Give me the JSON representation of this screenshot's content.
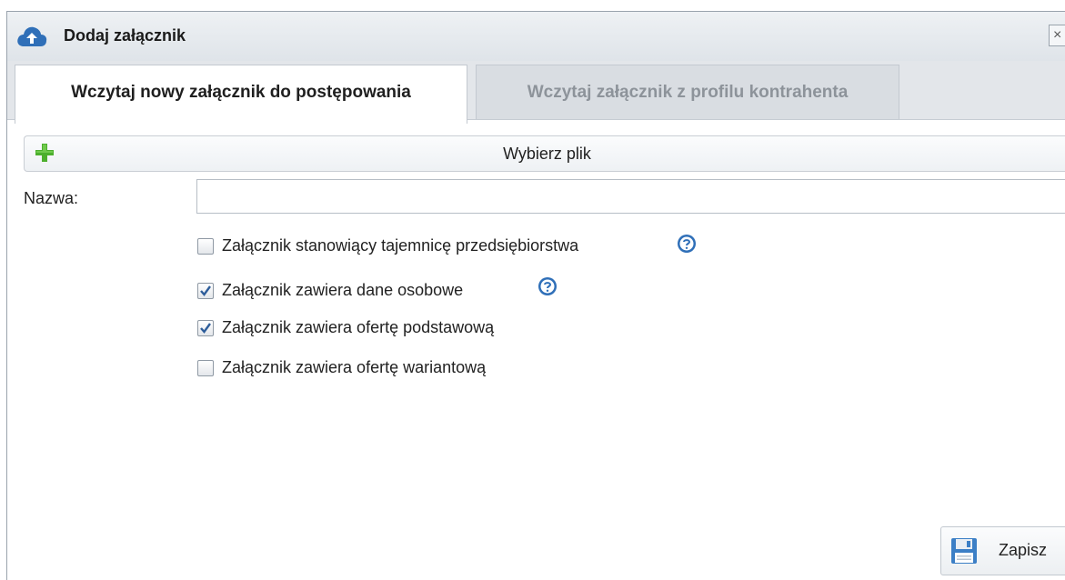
{
  "dialog": {
    "title": "Dodaj załącznik",
    "title_icon": "cloud-upload-icon",
    "close_icon": "close-icon",
    "close_glyph": "×"
  },
  "tabs": [
    {
      "label": "Wczytaj nowy załącznik do postępowania",
      "active": true
    },
    {
      "label": "Wczytaj załącznik z profilu kontrahenta",
      "active": false
    }
  ],
  "file_picker": {
    "icon": "plus-icon",
    "label": "Wybierz plik"
  },
  "name_field": {
    "label": "Nazwa:",
    "value": "",
    "placeholder": ""
  },
  "checkboxes": [
    {
      "label": "Załącznik stanowiący tajemnicę przedsiębiorstwa",
      "checked": false,
      "has_help": true
    },
    {
      "label": "Załącznik zawiera dane osobowe",
      "checked": true,
      "has_help": true
    },
    {
      "label": "Załącznik zawiera ofertę podstawową",
      "checked": true,
      "has_help": false
    },
    {
      "label": "Załącznik zawiera ofertę wariantową",
      "checked": false,
      "has_help": false
    }
  ],
  "help_icon": "help-icon",
  "save_button": {
    "label": "Zapisz",
    "icon": "floppy-disk-icon"
  },
  "colors": {
    "accent_blue": "#2f6fb8",
    "plus_green": "#4caf2d",
    "checkmark_blue": "#2d5d9a"
  }
}
